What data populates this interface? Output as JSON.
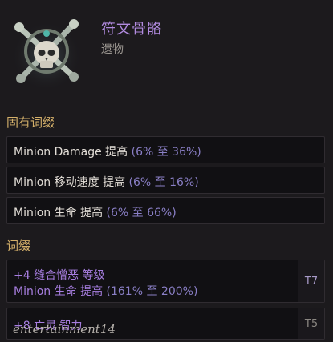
{
  "item": {
    "name": "符文骨骼",
    "type": "遗物",
    "icon": "skull-crossed-bones-relic-icon"
  },
  "implicit_section": {
    "title": "固有词缀",
    "mods": [
      {
        "name": "Minion Damage 提高",
        "range": "(6% 至 36%)"
      },
      {
        "name": "Minion 移动速度 提高",
        "range": "(6% 至 16%)"
      },
      {
        "name": "Minion 生命 提高",
        "range": "(6% 至 66%)"
      }
    ]
  },
  "affix_section": {
    "title": "词缀",
    "mods": [
      {
        "line1": "+4 缝合憎恶 等级",
        "line2_name": "Minion 生命 提高",
        "line2_range": "(161% 至 200%)",
        "tier": "T7"
      },
      {
        "line1": "+8 亡灵 智力",
        "tier": "T5"
      }
    ]
  },
  "watermark": "entertainment14",
  "colors": {
    "item_name": "#b28be0",
    "section_title": "#d4b06a",
    "affix_text": "#a77ee0",
    "range_text": "#8a7fc6"
  }
}
